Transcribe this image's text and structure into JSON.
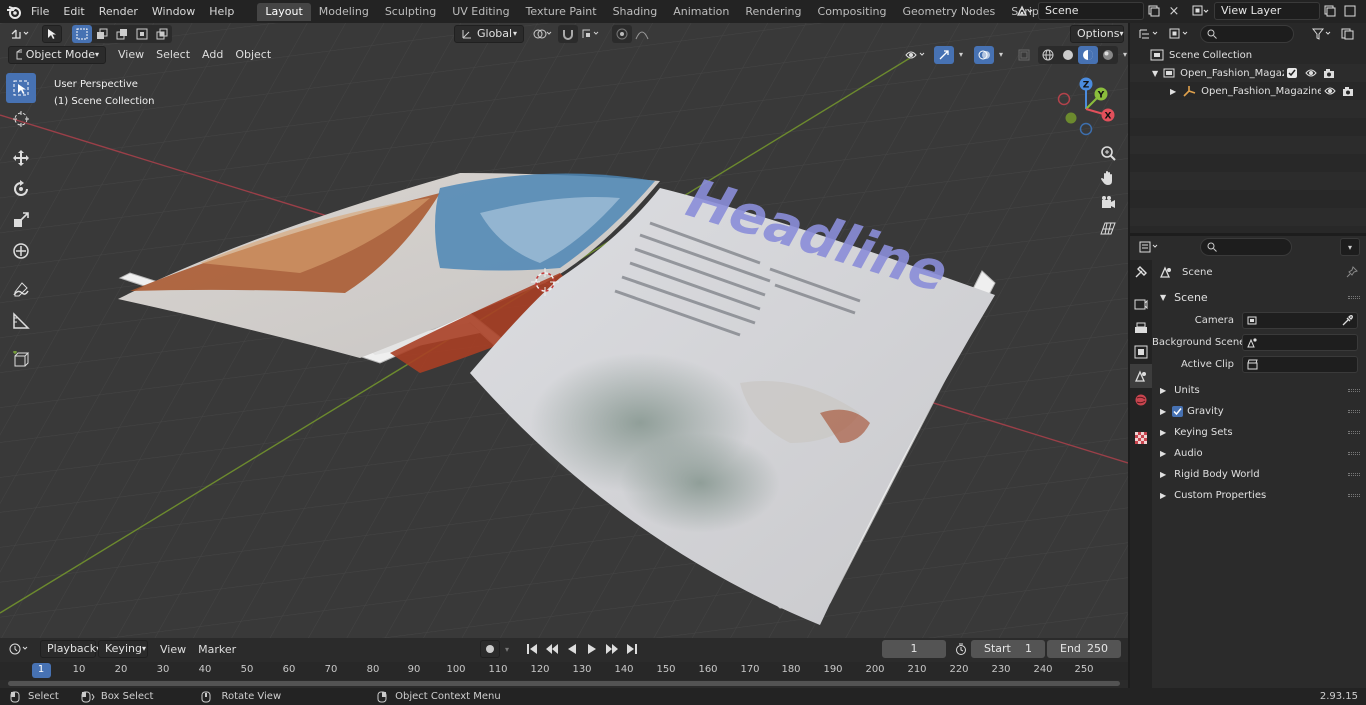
{
  "topbar": {
    "menus": [
      "File",
      "Edit",
      "Render",
      "Window",
      "Help"
    ],
    "workspaces": [
      "Layout",
      "Modeling",
      "Sculpting",
      "UV Editing",
      "Texture Paint",
      "Shading",
      "Animation",
      "Rendering",
      "Compositing",
      "Geometry Nodes",
      "Scripting"
    ],
    "active_workspace": "Layout",
    "add_workspace": "+",
    "scene_name": "Scene",
    "view_layer": "View Layer"
  },
  "viewport": {
    "mode": "Object Mode",
    "menus": [
      "View",
      "Select",
      "Add",
      "Object"
    ],
    "transform_orientation": "Global",
    "options_label": "Options",
    "perspective_label": "User Perspective",
    "collection_label": "(1) Scene Collection",
    "headline_text": "Headline",
    "gizmo": {
      "z": "Z",
      "y": "Y",
      "x": "X"
    }
  },
  "timeline": {
    "menus": [
      "Playback",
      "Keying",
      "View",
      "Marker"
    ],
    "current_frame": "1",
    "start_label": "Start",
    "start_value": "1",
    "end_label": "End",
    "end_value": "250",
    "ticks": [
      "1",
      "10",
      "20",
      "30",
      "40",
      "50",
      "60",
      "70",
      "80",
      "90",
      "100",
      "110",
      "120",
      "130",
      "140",
      "150",
      "160",
      "170",
      "180",
      "190",
      "200",
      "210",
      "220",
      "230",
      "240",
      "250"
    ]
  },
  "statusbar": {
    "select": "Select",
    "box_select": "Box Select",
    "rotate_view": "Rotate View",
    "context_menu": "Object Context Menu",
    "version": "2.93.15"
  },
  "outliner": {
    "root": "Scene Collection",
    "collection": "Open_Fashion_Magazine_Mo",
    "object": "Open_Fashion_Magazine"
  },
  "properties": {
    "context": "Scene",
    "panel_scene": "Scene",
    "camera_label": "Camera",
    "background_scene_label": "Background Scene",
    "active_clip_label": "Active Clip",
    "panels": [
      "Units",
      "Gravity",
      "Keying Sets",
      "Audio",
      "Rigid Body World",
      "Custom Properties"
    ]
  },
  "colors": {
    "accent": "#4772b3",
    "x_axis": "#e2505b",
    "y_axis": "#8bbe3c",
    "z_axis": "#4b8cdf",
    "headline": "#8b8ed9"
  }
}
